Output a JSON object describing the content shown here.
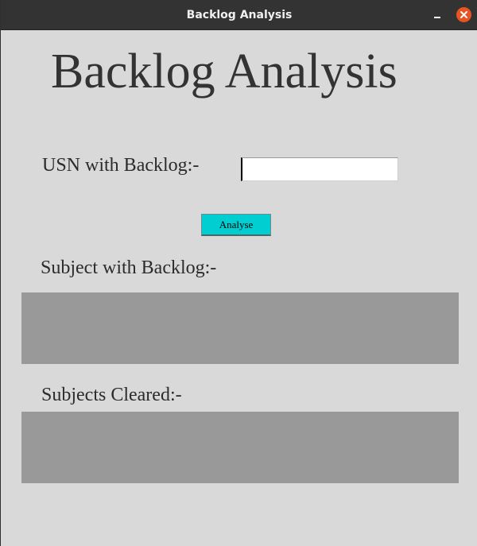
{
  "window": {
    "title": "Backlog Analysis"
  },
  "main": {
    "heading": "Backlog Analysis",
    "usn_label": "USN with Backlog:-",
    "usn_input_value": "",
    "analyse_label": "Analyse",
    "backlog_label": "Subject with Backlog:-",
    "backlog_result": "",
    "cleared_label": "Subjects Cleared:-",
    "cleared_result": ""
  },
  "colors": {
    "window_background": "#d9d9d9",
    "titlebar": "#333333",
    "close_button": "#e95420",
    "analyse_button": "#00ced1",
    "result_box": "#999999"
  },
  "icons": {
    "minimize": "minimize-icon",
    "close": "close-icon"
  }
}
